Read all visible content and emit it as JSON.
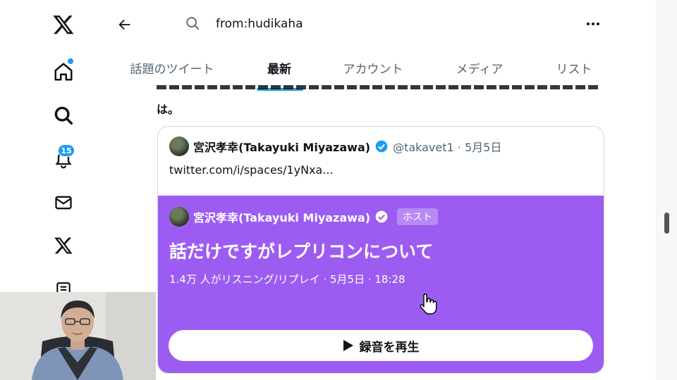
{
  "nav": {
    "notifications_badge": "15"
  },
  "search": {
    "query": "from:hudikaha"
  },
  "tabs": [
    {
      "label": "話題のツイート",
      "active": false
    },
    {
      "label": "最新",
      "active": true
    },
    {
      "label": "アカウント",
      "active": false
    },
    {
      "label": "メディア",
      "active": false
    },
    {
      "label": "リスト",
      "active": false
    }
  ],
  "tweet": {
    "trailing_text": "は。"
  },
  "quote": {
    "author_name": "宮沢孝幸(Takayuki Miyazawa)",
    "handle_date": "@takavet1 · 5月5日",
    "link_text": "twitter.com/i/spaces/1yNxa..."
  },
  "space": {
    "host_name": "宮沢孝幸(Takayuki Miyazawa)",
    "host_label": "ホスト",
    "title": "話だけですがレプリコンについて",
    "meta": "1.4万 人がリスニング/リプレイ · 5月5日 · 18:28",
    "play_label": "録音を再生"
  },
  "colors": {
    "space_background": "#9c5cf2",
    "accent": "#1d9bf0"
  }
}
